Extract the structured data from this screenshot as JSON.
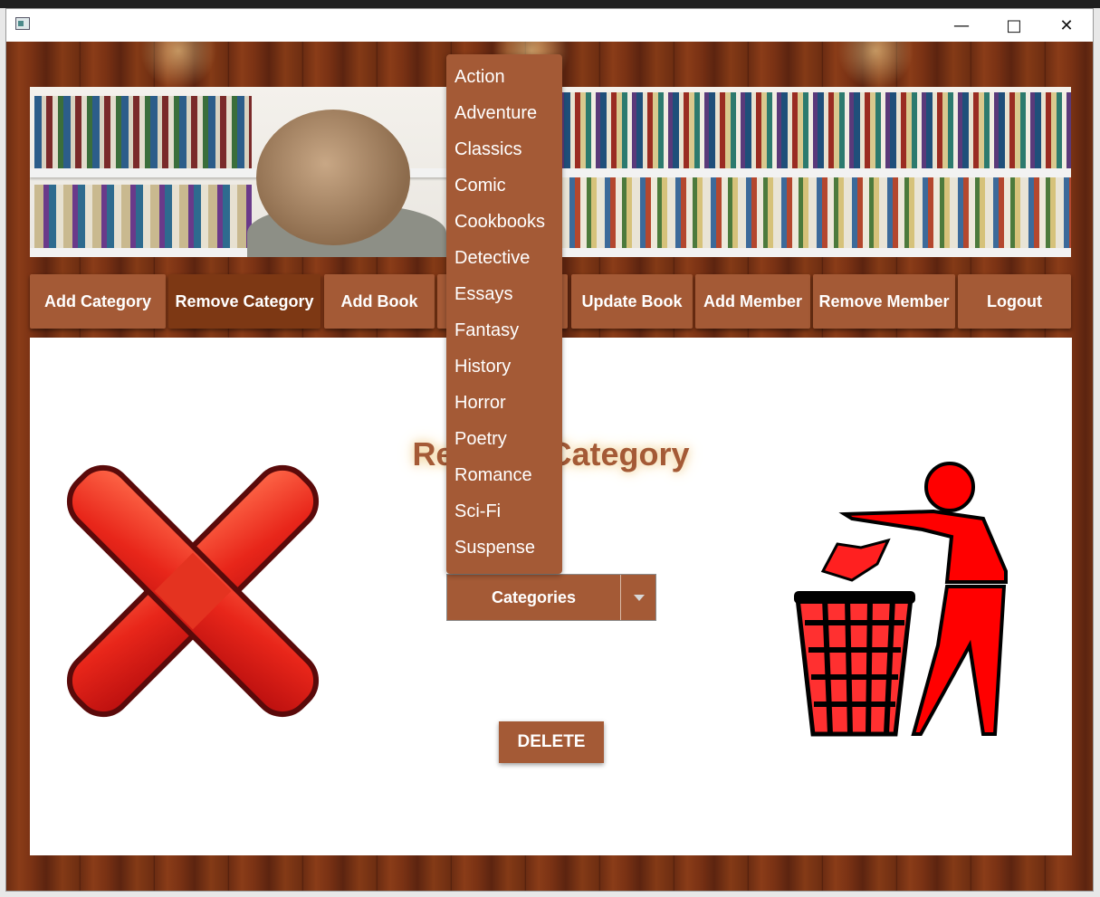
{
  "nav": {
    "add_category": "Add Category",
    "remove_category": "Remove Category",
    "add_book": "Add Book",
    "update_book": "Update Book",
    "add_member": "Add Member",
    "remove_member": "Remove Member",
    "logout": "Logout"
  },
  "main": {
    "heading": "Remove Category",
    "category_select": {
      "selected": "Categories"
    },
    "delete_label": "DELETE"
  },
  "dropdown": {
    "options": [
      "Action",
      "Adventure",
      "Classics",
      "Comic",
      "Cookbooks",
      "Detective",
      "Essays",
      "Fantasy",
      "History",
      "Horror",
      "Poetry",
      "Romance",
      "Sci-Fi",
      "Suspense"
    ]
  },
  "colors": {
    "accent": "#a45a36",
    "accent_active": "#7d3814",
    "icon_red": "#ff0000"
  },
  "icons": [
    "app-icon",
    "minimize-icon",
    "maximize-icon",
    "close-icon",
    "x-mark-icon",
    "trash-icon",
    "chevron-down-icon"
  ]
}
